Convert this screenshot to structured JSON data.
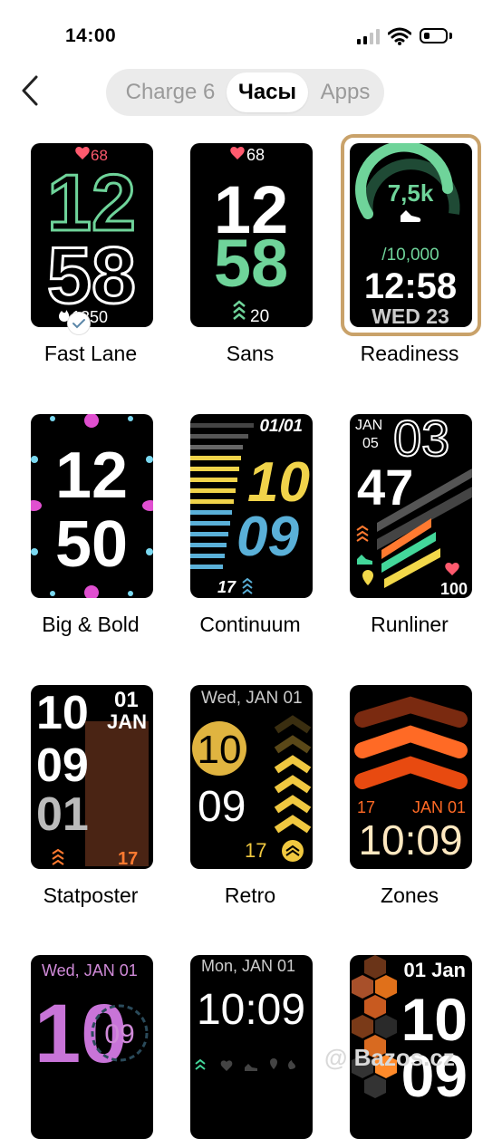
{
  "status": {
    "time": "14:00"
  },
  "tabs": [
    {
      "label": "Charge 6",
      "selected": false
    },
    {
      "label": "Часы",
      "selected": true
    },
    {
      "label": "Apps",
      "selected": false
    }
  ],
  "faces": [
    {
      "name": "Fast Lane",
      "heart": "68",
      "hour": "12",
      "min": "58",
      "steps": "1350",
      "selected": true
    },
    {
      "name": "Sans",
      "heart": "68",
      "hour": "12",
      "min": "58",
      "floors": "20"
    },
    {
      "name": "Readiness",
      "steps": "7,5k",
      "goal": "/10,000",
      "time": "12:58",
      "date": "WED 23"
    },
    {
      "name": "Big & Bold",
      "hour": "12",
      "min": "50"
    },
    {
      "name": "Continuum",
      "date": "01/01",
      "hour": "10",
      "min": "09",
      "floors": "17"
    },
    {
      "name": "Runliner",
      "month": "JAN",
      "day": "05",
      "hour": "03",
      "min": "47",
      "heart": "100"
    },
    {
      "name": "Statposter",
      "hour": "10",
      "min": "09",
      "sec": "01",
      "day": "01",
      "month": "JAN",
      "floors": "17"
    },
    {
      "name": "Retro",
      "date": "Wed, JAN 01",
      "hour": "10",
      "min": "09",
      "floors": "17"
    },
    {
      "name": "Zones",
      "floors": "17",
      "date": "JAN 01",
      "time": "10:09"
    },
    {
      "date": "Wed, JAN 01",
      "hour": "10",
      "min": "09"
    },
    {
      "date": "Mon, JAN 01",
      "time": "10:09"
    },
    {
      "date": "01 Jan",
      "hour": "10",
      "min": "09"
    }
  ],
  "watermark": "@ Bazos.cz",
  "colors": {
    "accent_green": "#6fd49a",
    "selected_border": "#c9a26a",
    "heart": "#ff5a6e"
  }
}
